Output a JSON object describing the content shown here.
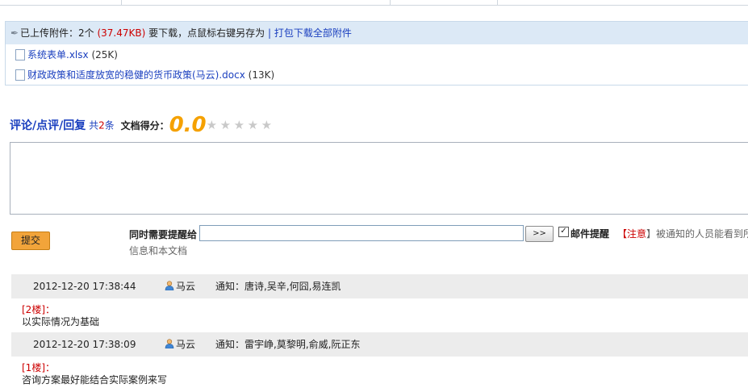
{
  "attachments": {
    "header_prefix": "已上传附件：2个",
    "header_size": "(37.47KB)",
    "header_suffix": "要下载，点鼠标右键另存为",
    "divider": "|",
    "download_all": "打包下载全部附件",
    "files": [
      {
        "name": "系统表单.xlsx",
        "size": "(25K)"
      },
      {
        "name": "财政政策和适度放宽的稳健的货币政策(马云).docx",
        "size": "(13K)"
      }
    ]
  },
  "comments": {
    "title": "评论/点评/回复",
    "count_prefix": "共",
    "count": "2",
    "count_suffix": "条",
    "score_label": "文档得分：",
    "score": "0.0",
    "rating": 0,
    "max_rating": 5
  },
  "form": {
    "submit": "提交",
    "remind_label": "同时需要提醒给",
    "remind_sub": "信息和本文档",
    "remind_value": "",
    "arrow_button": ">>",
    "mail_checkbox": "✓",
    "mail_label": "邮件提醒",
    "notice_prefix": "【",
    "notice_red": "注意",
    "notice_suffix": "】被通知的人员能看到所"
  },
  "entries": [
    {
      "time": "2012-12-20 17:38:44",
      "user": "马云",
      "notify": "通知：唐诗,吴辛,何囧,易连凯",
      "floor": "[2楼]：",
      "text": "以实际情况为基础"
    },
    {
      "time": "2012-12-20 17:38:09",
      "user": "马云",
      "notify": "通知：雷宇峥,莫黎明,俞威,阮正东",
      "floor": "[1楼]：",
      "text": "咨询方案最好能结合实际案例来写"
    }
  ],
  "colors": {
    "link": "#1a3fbf",
    "red": "#cc0000",
    "score": "#f5a100",
    "submit": "#f2a43a",
    "head_bg": "#dce9f6"
  }
}
